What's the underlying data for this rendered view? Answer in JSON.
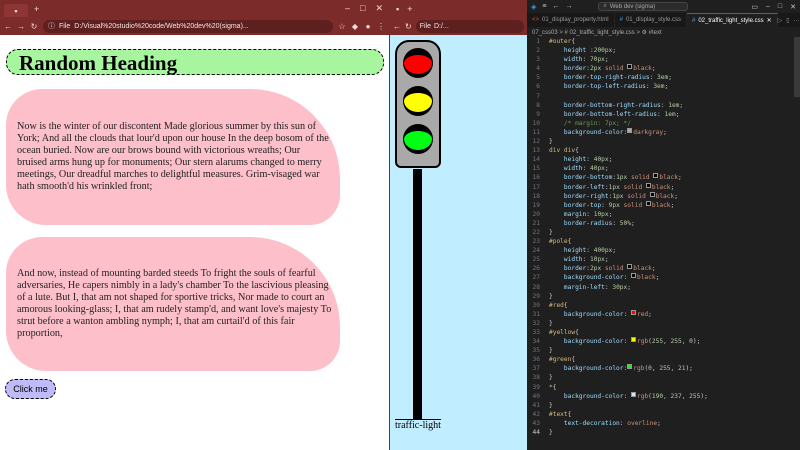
{
  "browser1": {
    "tab_plus": "+",
    "win_min": "–",
    "win_max": "□",
    "win_close": "✕",
    "file_label": "File",
    "url": "D:/Visual%20studio%20code/Web%20dev%20(sigma)...",
    "heading": "Random Heading",
    "para1": "Now is the winter of our discontent Made glorious summer by this sun of York; And all the clouds that lour'd upon our house In the deep bosom of the ocean buried. Now are our brows bound with victorious wreaths; Our bruised arms hung up for monuments; Our stern alarums changed to merry meetings, Our dreadful marches to delightful measures. Grim-visaged war hath smooth'd his wrinkled front;",
    "para2": "And now, instead of mounting barded steeds To fright the souls of fearful adversaries, He capers nimbly in a lady's chamber To the lascivious pleasing of a lute. But I, that am not shaped for sportive tricks, Nor made to court an amorous looking-glass; I, that am rudely stamp'd, and want love's majesty To strut before a wanton ambling nymph; I, that am curtail'd of this fair proportion,",
    "button": "Click me"
  },
  "browser2": {
    "tab_plus": "+",
    "file_label": "File",
    "url": "D:/...",
    "label": "traffic-light"
  },
  "vscode": {
    "search": "Web dev (sigma)",
    "tabs": [
      {
        "icon": "<>",
        "label": "01_display_property.html"
      },
      {
        "icon": "#",
        "label": "01_display_style.css"
      },
      {
        "icon": "#",
        "label": "02_traffic_light_style.css"
      }
    ],
    "breadcrumb": "07_css03 > # 02_traffic_light_style.css > ⚙ #text",
    "colors": {
      "black": "#000000",
      "darkgray": "#a9a9a9",
      "red": "#ff0000",
      "yellow": "#ffff00",
      "green": "#00ff15",
      "lightblue": "#beedff"
    }
  }
}
